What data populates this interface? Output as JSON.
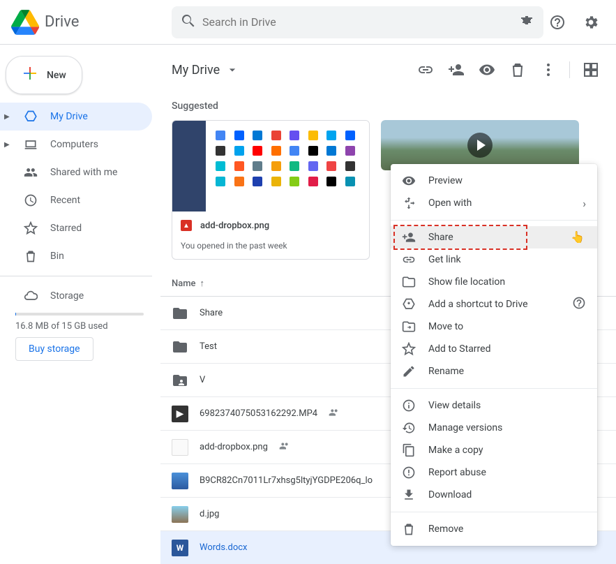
{
  "header": {
    "title": "Drive",
    "search_placeholder": "Search in Drive"
  },
  "sidebar": {
    "new_label": "New",
    "items": [
      {
        "label": "My Drive",
        "active": true,
        "expandable": true
      },
      {
        "label": "Computers",
        "expandable": true
      },
      {
        "label": "Shared with me"
      },
      {
        "label": "Recent"
      },
      {
        "label": "Starred"
      },
      {
        "label": "Bin"
      }
    ],
    "storage_label": "Storage",
    "storage_used": "16.8 MB of 15 GB used",
    "buy_label": "Buy storage"
  },
  "toolbar": {
    "breadcrumb": "My Drive"
  },
  "suggested": {
    "label": "Suggested",
    "cards": [
      {
        "title": "add-dropbox.png",
        "subtitle": "You opened in the past week"
      }
    ]
  },
  "list": {
    "name_header": "Name",
    "sort": "asc",
    "rows": [
      {
        "name": "Share",
        "type": "folder"
      },
      {
        "name": "Test",
        "type": "folder"
      },
      {
        "name": "V",
        "type": "folder-shared"
      },
      {
        "name": "6982374075053162292.MP4",
        "type": "video",
        "shared": true
      },
      {
        "name": "add-dropbox.png",
        "type": "image",
        "shared": true
      },
      {
        "name": "B9CR82Cn7011Lr7xhsg5ltyjYGDPE206q_lo",
        "type": "image-wide"
      },
      {
        "name": "d.jpg",
        "type": "image"
      },
      {
        "name": "Words.docx",
        "type": "docx",
        "selected": true
      }
    ]
  },
  "context_menu": {
    "preview": "Preview",
    "open_with": "Open with",
    "share": "Share",
    "get_link": "Get link",
    "show_location": "Show file location",
    "add_shortcut": "Add a shortcut to Drive",
    "move_to": "Move to",
    "starred": "Add to Starred",
    "rename": "Rename",
    "view_details": "View details",
    "manage_versions": "Manage versions",
    "make_copy": "Make a copy",
    "report_abuse": "Report abuse",
    "download": "Download",
    "remove": "Remove"
  }
}
